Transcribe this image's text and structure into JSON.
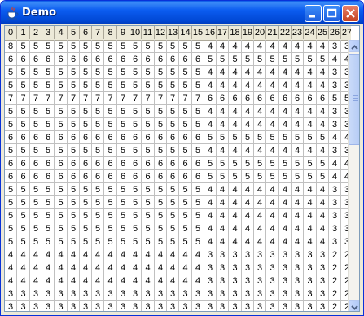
{
  "window": {
    "title": "Demo"
  },
  "icons": {
    "app": "java-cup-icon",
    "minimize": "minimize-icon",
    "maximize": "maximize-icon",
    "close": "close-icon",
    "scroll_up": "arrow-up-icon",
    "scroll_down": "arrow-down-icon"
  },
  "colors": {
    "title_bar": "#0b5cf0",
    "close_button": "#c44221",
    "grid_lines": "#c0c0c0",
    "header_bg": "#ece9d8"
  },
  "table": {
    "columns": [
      "0",
      "1",
      "2",
      "3",
      "4",
      "5",
      "6",
      "7",
      "8",
      "9",
      "10",
      "11",
      "12",
      "13",
      "14",
      "15",
      "16",
      "17",
      "18",
      "19",
      "20",
      "21",
      "22",
      "23",
      "24",
      "25",
      "26",
      "27"
    ],
    "rows": [
      [
        "8",
        "5",
        "5",
        "5",
        "5",
        "5",
        "5",
        "5",
        "5",
        "5",
        "5",
        "5",
        "5",
        "5",
        "5",
        "5",
        "4",
        "4",
        "4",
        "4",
        "4",
        "4",
        "4",
        "4",
        "4",
        "4",
        "3",
        "3"
      ],
      [
        "6",
        "6",
        "6",
        "6",
        "6",
        "6",
        "6",
        "6",
        "6",
        "6",
        "6",
        "6",
        "6",
        "6",
        "6",
        "6",
        "5",
        "5",
        "5",
        "5",
        "5",
        "5",
        "5",
        "5",
        "5",
        "5",
        "4",
        "4"
      ],
      [
        "5",
        "5",
        "5",
        "5",
        "5",
        "5",
        "5",
        "5",
        "5",
        "5",
        "5",
        "5",
        "5",
        "5",
        "5",
        "5",
        "4",
        "4",
        "4",
        "4",
        "4",
        "4",
        "4",
        "4",
        "4",
        "4",
        "3",
        "3"
      ],
      [
        "5",
        "5",
        "5",
        "5",
        "5",
        "5",
        "5",
        "5",
        "5",
        "5",
        "5",
        "5",
        "5",
        "5",
        "5",
        "5",
        "4",
        "4",
        "4",
        "4",
        "4",
        "4",
        "4",
        "4",
        "4",
        "4",
        "3",
        "3"
      ],
      [
        "7",
        "7",
        "7",
        "7",
        "7",
        "7",
        "7",
        "7",
        "7",
        "7",
        "7",
        "7",
        "7",
        "7",
        "7",
        "7",
        "6",
        "6",
        "6",
        "6",
        "6",
        "6",
        "6",
        "6",
        "6",
        "6",
        "5",
        "5"
      ],
      [
        "5",
        "5",
        "5",
        "5",
        "5",
        "5",
        "5",
        "5",
        "5",
        "5",
        "5",
        "5",
        "5",
        "5",
        "5",
        "5",
        "4",
        "4",
        "4",
        "4",
        "4",
        "4",
        "4",
        "4",
        "4",
        "4",
        "3",
        "3"
      ],
      [
        "5",
        "5",
        "5",
        "5",
        "5",
        "5",
        "5",
        "5",
        "5",
        "5",
        "5",
        "5",
        "5",
        "5",
        "5",
        "5",
        "4",
        "4",
        "4",
        "4",
        "4",
        "4",
        "4",
        "4",
        "4",
        "4",
        "3",
        "3"
      ],
      [
        "6",
        "6",
        "6",
        "6",
        "6",
        "6",
        "6",
        "6",
        "6",
        "6",
        "6",
        "6",
        "6",
        "6",
        "6",
        "6",
        "5",
        "5",
        "5",
        "5",
        "5",
        "5",
        "5",
        "5",
        "5",
        "5",
        "4",
        "4"
      ],
      [
        "5",
        "5",
        "5",
        "5",
        "5",
        "5",
        "5",
        "5",
        "5",
        "5",
        "5",
        "5",
        "5",
        "5",
        "5",
        "5",
        "4",
        "4",
        "4",
        "4",
        "4",
        "4",
        "4",
        "4",
        "4",
        "4",
        "3",
        "3"
      ],
      [
        "6",
        "6",
        "6",
        "6",
        "6",
        "6",
        "6",
        "6",
        "6",
        "6",
        "6",
        "6",
        "6",
        "6",
        "6",
        "6",
        "5",
        "5",
        "5",
        "5",
        "5",
        "5",
        "5",
        "5",
        "5",
        "5",
        "4",
        "4"
      ],
      [
        "6",
        "6",
        "6",
        "6",
        "6",
        "6",
        "6",
        "6",
        "6",
        "6",
        "6",
        "6",
        "6",
        "6",
        "6",
        "6",
        "5",
        "5",
        "5",
        "5",
        "5",
        "5",
        "5",
        "5",
        "5",
        "5",
        "4",
        "4"
      ],
      [
        "5",
        "5",
        "5",
        "5",
        "5",
        "5",
        "5",
        "5",
        "5",
        "5",
        "5",
        "5",
        "5",
        "5",
        "5",
        "5",
        "4",
        "4",
        "4",
        "4",
        "4",
        "4",
        "4",
        "4",
        "4",
        "4",
        "3",
        "3"
      ],
      [
        "5",
        "5",
        "5",
        "5",
        "5",
        "5",
        "5",
        "5",
        "5",
        "5",
        "5",
        "5",
        "5",
        "5",
        "5",
        "5",
        "4",
        "4",
        "4",
        "4",
        "4",
        "4",
        "4",
        "4",
        "4",
        "4",
        "3",
        "3"
      ],
      [
        "5",
        "5",
        "5",
        "5",
        "5",
        "5",
        "5",
        "5",
        "5",
        "5",
        "5",
        "5",
        "5",
        "5",
        "5",
        "5",
        "4",
        "4",
        "4",
        "4",
        "4",
        "4",
        "4",
        "4",
        "4",
        "4",
        "3",
        "3"
      ],
      [
        "5",
        "5",
        "5",
        "5",
        "5",
        "5",
        "5",
        "5",
        "5",
        "5",
        "5",
        "5",
        "5",
        "5",
        "5",
        "5",
        "4",
        "4",
        "4",
        "4",
        "4",
        "4",
        "4",
        "4",
        "4",
        "4",
        "3",
        "3"
      ],
      [
        "5",
        "5",
        "5",
        "5",
        "5",
        "5",
        "5",
        "5",
        "5",
        "5",
        "5",
        "5",
        "5",
        "5",
        "5",
        "5",
        "4",
        "4",
        "4",
        "4",
        "4",
        "4",
        "4",
        "4",
        "4",
        "4",
        "3",
        "3"
      ],
      [
        "4",
        "4",
        "4",
        "4",
        "4",
        "4",
        "4",
        "4",
        "4",
        "4",
        "4",
        "4",
        "4",
        "4",
        "4",
        "4",
        "3",
        "3",
        "3",
        "3",
        "3",
        "3",
        "3",
        "3",
        "3",
        "3",
        "2",
        "2"
      ],
      [
        "4",
        "4",
        "4",
        "4",
        "4",
        "4",
        "4",
        "4",
        "4",
        "4",
        "4",
        "4",
        "4",
        "4",
        "4",
        "4",
        "3",
        "3",
        "3",
        "3",
        "3",
        "3",
        "3",
        "3",
        "3",
        "3",
        "2",
        "2"
      ],
      [
        "4",
        "4",
        "4",
        "4",
        "4",
        "4",
        "4",
        "4",
        "4",
        "4",
        "4",
        "4",
        "4",
        "4",
        "4",
        "4",
        "3",
        "3",
        "3",
        "3",
        "3",
        "3",
        "3",
        "3",
        "3",
        "3",
        "2",
        "2"
      ],
      [
        "3",
        "3",
        "3",
        "3",
        "3",
        "3",
        "3",
        "3",
        "3",
        "3",
        "3",
        "3",
        "3",
        "3",
        "3",
        "3",
        "3",
        "3",
        "3",
        "3",
        "3",
        "3",
        "3",
        "3",
        "3",
        "3",
        "2",
        "2"
      ],
      [
        "3",
        "3",
        "3",
        "3",
        "3",
        "3",
        "3",
        "3",
        "3",
        "3",
        "3",
        "3",
        "3",
        "3",
        "3",
        "3",
        "3",
        "3",
        "3",
        "3",
        "3",
        "3",
        "3",
        "3",
        "3",
        "3",
        "2",
        "2"
      ],
      [
        "3",
        "3",
        "3",
        "3",
        "3",
        "3",
        "3",
        "3",
        "3",
        "3",
        "3",
        "3",
        "3",
        "3",
        "3",
        "3",
        "3",
        "3",
        "3",
        "3",
        "3",
        "3",
        "3",
        "3",
        "3",
        "3",
        "2",
        "2"
      ]
    ]
  }
}
